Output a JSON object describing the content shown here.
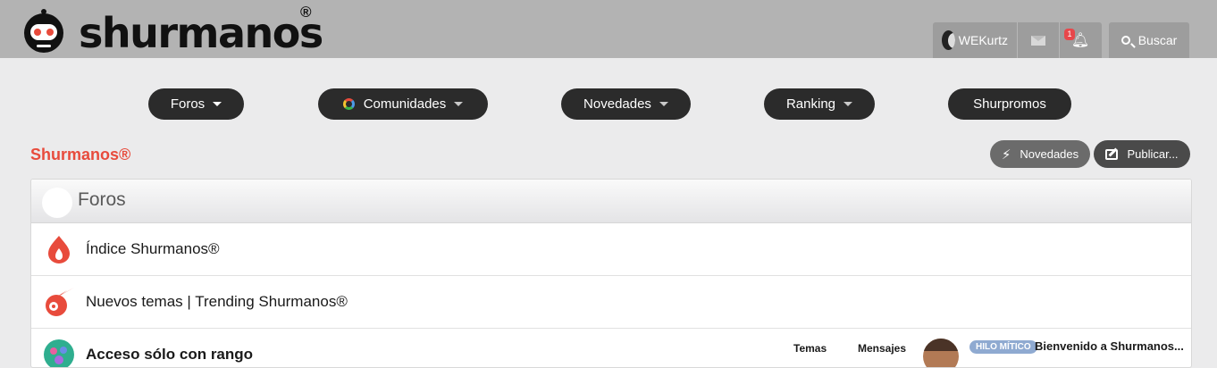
{
  "header": {
    "logo_text": "shurmanos",
    "logo_reg": "®",
    "username": "WEKurtz",
    "notification_count": "1",
    "search_label": "Buscar"
  },
  "nav": {
    "foros": "Foros",
    "comunidades": "Comunidades",
    "novedades": "Novedades",
    "ranking": "Ranking",
    "shurpromos": "Shurpromos"
  },
  "page": {
    "title": "Shurmanos®",
    "novedades_button": "Novedades",
    "publicar_button": "Publicar..."
  },
  "forum_block": {
    "header": "Foros",
    "rows": [
      {
        "title": "Índice Shurmanos®"
      },
      {
        "title": "Nuevos temas | Trending Shurmanos®"
      },
      {
        "title": "Acceso sólo con rango",
        "temas_label": "Temas",
        "mensajes_label": "Mensajes",
        "tag": "HILO MÍTICO",
        "last_post": "Bienvenido a Shurmanos..."
      }
    ]
  },
  "colors": {
    "accent": "#e84b3c",
    "header_bg": "#b3b3b3",
    "pill_bg": "#2b2b2b"
  }
}
